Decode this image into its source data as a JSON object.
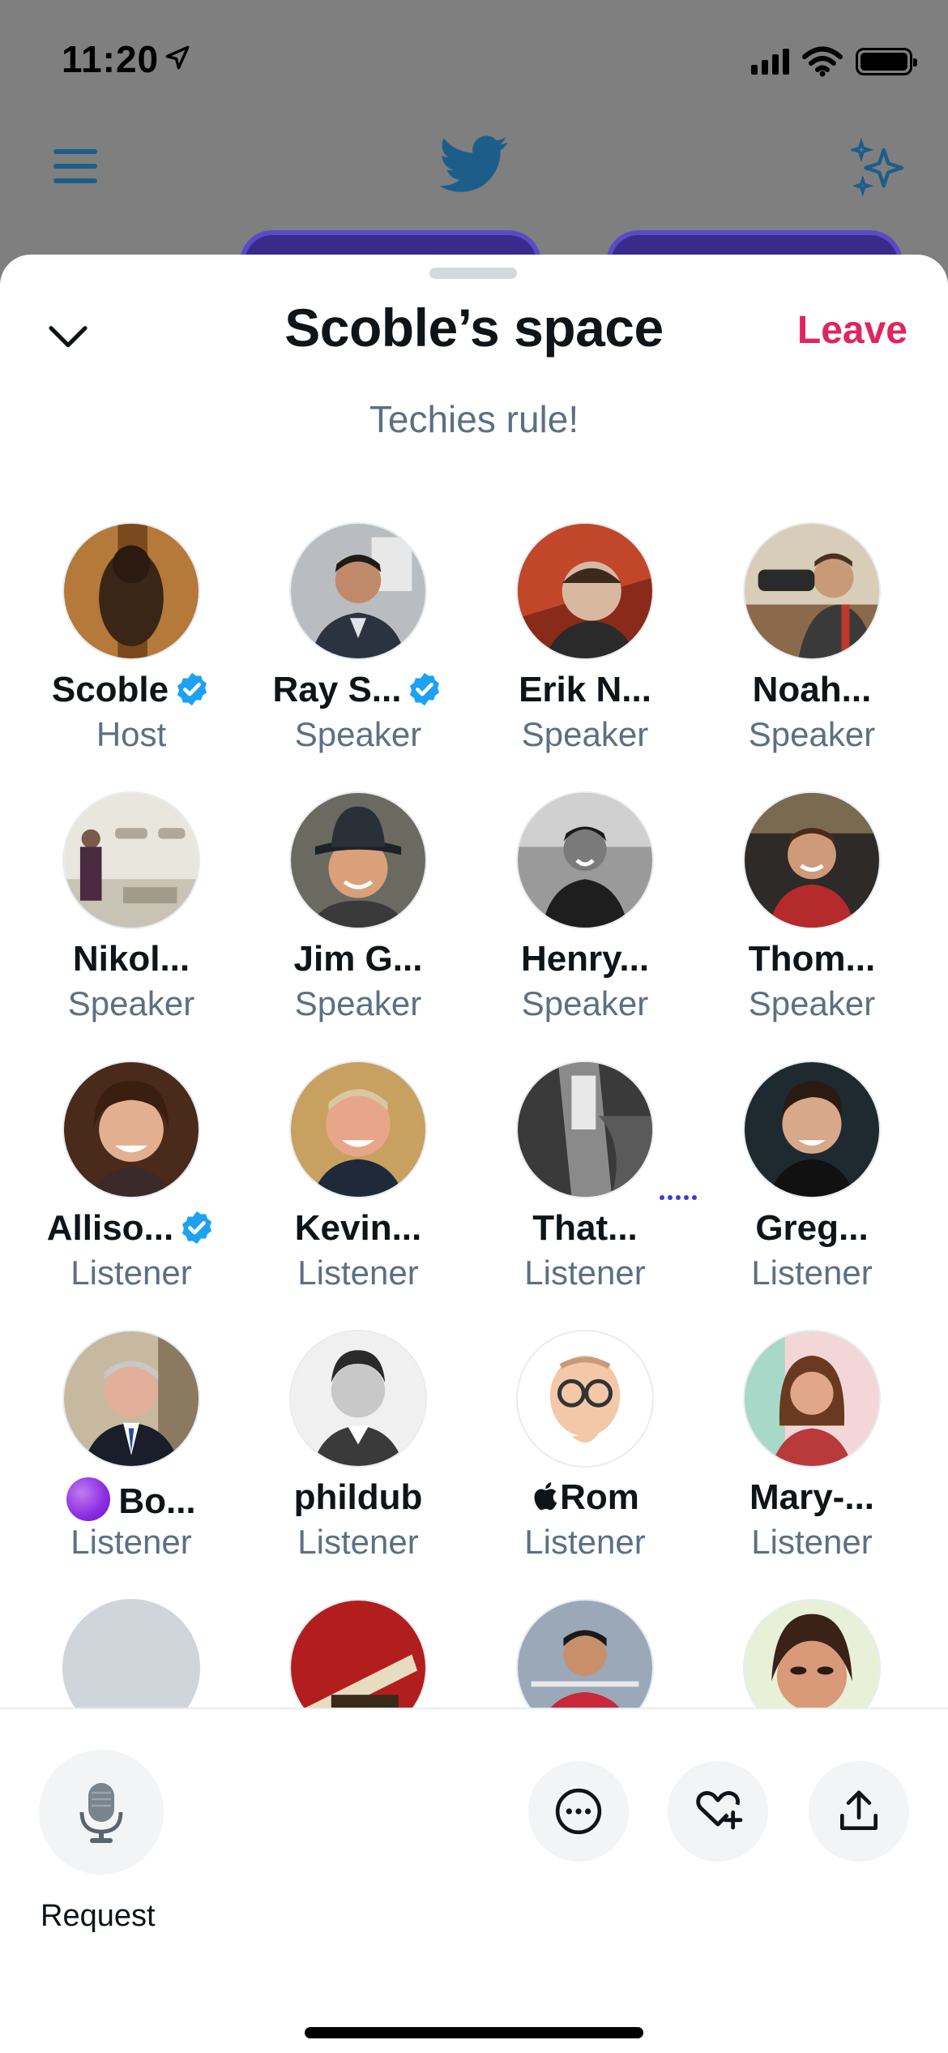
{
  "status_bar": {
    "time": "11:20"
  },
  "space": {
    "title": "Scoble’s space",
    "leave_label": "Leave",
    "subtitle": "Techies rule!"
  },
  "participants": [
    {
      "name": "Scoble",
      "role": "Host",
      "verified": true
    },
    {
      "name": "Ray S...",
      "role": "Speaker",
      "verified": true
    },
    {
      "name": "Erik N...",
      "role": "Speaker",
      "verified": false
    },
    {
      "name": "Noah...",
      "role": "Speaker",
      "verified": false
    },
    {
      "name": "Nikol...",
      "role": "Speaker",
      "verified": false
    },
    {
      "name": "Jim G...",
      "role": "Speaker",
      "verified": false
    },
    {
      "name": "Henry...",
      "role": "Speaker",
      "verified": false
    },
    {
      "name": "Thom...",
      "role": "Speaker",
      "verified": false,
      "speaking": true
    },
    {
      "name": "Alliso...",
      "role": "Listener",
      "verified": true
    },
    {
      "name": "Kevin...",
      "role": "Listener",
      "verified": false
    },
    {
      "name": "That...",
      "role": "Listener",
      "verified": false
    },
    {
      "name": "Greg...",
      "role": "Listener",
      "verified": false
    },
    {
      "name": "Bo...",
      "role": "Listener",
      "verified": false,
      "emoji_prefix": "purple-circle"
    },
    {
      "name": "phildub",
      "role": "Listener",
      "verified": false
    },
    {
      "name": "Rom",
      "role": "Listener",
      "verified": false,
      "emoji_prefix": "apple-logo"
    },
    {
      "name": "Mary-...",
      "role": "Listener",
      "verified": false
    }
  ],
  "bottom_bar": {
    "request_label": "Request"
  },
  "colors": {
    "leave": "#e0245e",
    "verified": "#1da1f2",
    "secondary_text": "#5b7083",
    "twitter_blue": "#1d9bf0"
  }
}
